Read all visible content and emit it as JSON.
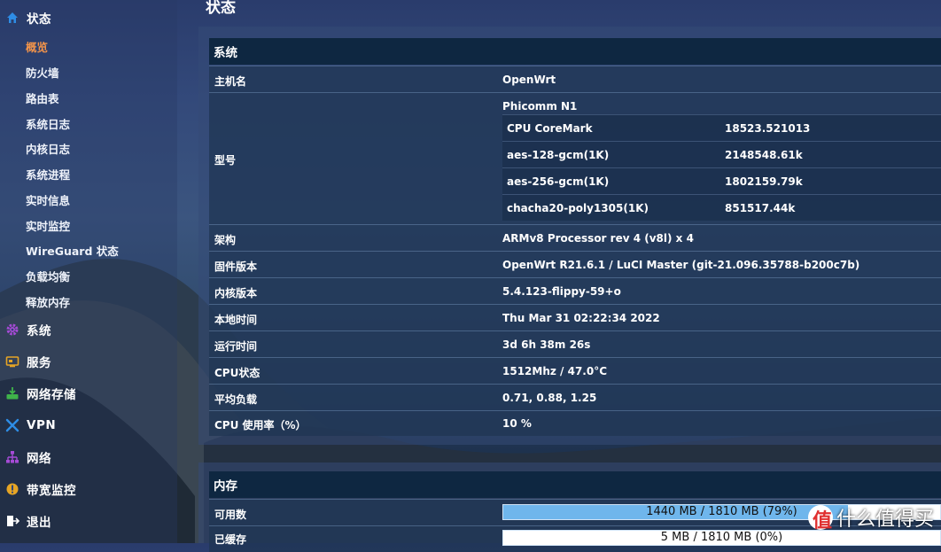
{
  "sidebar": {
    "status_label": "状态",
    "status_items": [
      "概览",
      "防火墙",
      "路由表",
      "系统日志",
      "内核日志",
      "系统进程",
      "实时信息",
      "实时监控",
      "WireGuard 状态",
      "负载均衡",
      "释放内存"
    ],
    "groups": [
      {
        "label": "系统",
        "icon": "gear-icon",
        "color": "#a64bd6"
      },
      {
        "label": "服务",
        "icon": "services-icon",
        "color": "#e6a525"
      },
      {
        "label": "网络存储",
        "icon": "storage-icon",
        "color": "#3fb34a"
      },
      {
        "label": "VPN",
        "icon": "vpn-icon",
        "color": "#2e8de6"
      },
      {
        "label": "网络",
        "icon": "network-icon",
        "color": "#a64bd6"
      },
      {
        "label": "带宽监控",
        "icon": "bandwidth-icon",
        "color": "#e6a525"
      },
      {
        "label": "退出",
        "icon": "logout-icon",
        "color": "#ffffff"
      }
    ]
  },
  "main": {
    "title": "状态",
    "system": {
      "heading": "系统",
      "hostname": {
        "key": "主机名",
        "value": "OpenWrt"
      },
      "model": {
        "key": "型号",
        "value": "Phicomm N1",
        "bench": [
          {
            "k": "CPU CoreMark",
            "v": "18523.521013"
          },
          {
            "k": "aes-128-gcm(1K)",
            "v": "2148548.61k"
          },
          {
            "k": "aes-256-gcm(1K)",
            "v": "1802159.79k"
          },
          {
            "k": "chacha20-poly1305(1K)",
            "v": "851517.44k"
          }
        ]
      },
      "rows": [
        {
          "key": "架构",
          "value": "ARMv8 Processor rev 4 (v8l) x 4"
        },
        {
          "key": "固件版本",
          "value": "OpenWrt R21.6.1 / LuCI Master (git-21.096.35788-b200c7b)"
        },
        {
          "key": "内核版本",
          "value": "5.4.123-flippy-59+o"
        },
        {
          "key": "本地时间",
          "value": "Thu Mar 31 02:22:34 2022"
        },
        {
          "key": "运行时间",
          "value": "3d 6h 38m 26s"
        },
        {
          "key": "CPU状态",
          "value": "1512Mhz / 47.0°C"
        },
        {
          "key": "平均负载",
          "value": "0.71, 0.88, 1.25"
        },
        {
          "key": "CPU 使用率（%）",
          "value": "10 %"
        }
      ]
    },
    "memory": {
      "heading": "内存",
      "rows": [
        {
          "key": "可用数",
          "text": "1440 MB / 1810 MB (79%)",
          "fraction": 0.79
        },
        {
          "key": "已缓存",
          "text": "5 MB / 1810 MB (0%)",
          "fraction": 0.0
        }
      ]
    }
  },
  "watermark": {
    "glyph": "值",
    "text": "什么值得买"
  }
}
